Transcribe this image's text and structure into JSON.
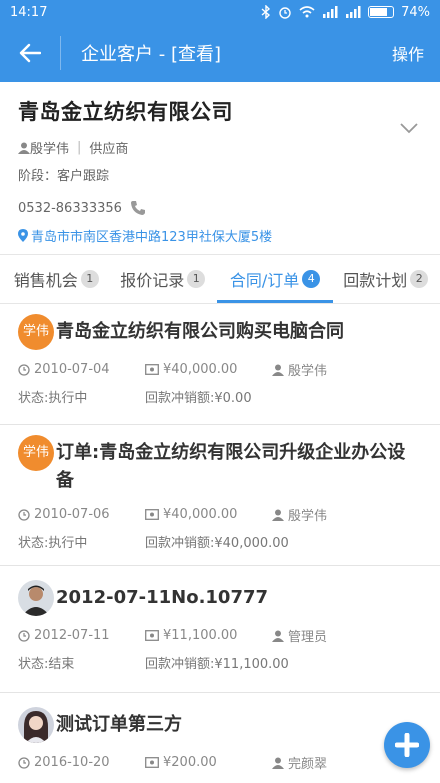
{
  "statusbar": {
    "time": "14:17",
    "battery": "74%"
  },
  "appbar": {
    "title": "企业客户 - [查看]",
    "action": "操作"
  },
  "company": {
    "name": "青岛金立纺织有限公司",
    "owner": "殷学伟",
    "type": "供应商",
    "stage": "阶段：客户跟踪",
    "phone": "0532-86333356",
    "address": "青岛市市南区香港中路123甲社保大厦5楼"
  },
  "tabs": [
    {
      "label": "销售机会",
      "count": "1"
    },
    {
      "label": "报价记录",
      "count": "1"
    },
    {
      "label": "合同/订单",
      "count": "4"
    },
    {
      "label": "回款计划",
      "count": "2"
    }
  ],
  "orders": [
    {
      "avatar_text": "学伟",
      "title": "青岛金立纺织有限公司购买电脑合同",
      "date": "2010-07-04",
      "amount": "¥40,000.00",
      "person": "殷学伟",
      "status": "状态:执行中",
      "writeoff": "回款冲销额:¥0.00"
    },
    {
      "avatar_text": "学伟",
      "title": "订单:青岛金立纺织有限公司升级企业办公设备",
      "date": "2010-07-06",
      "amount": "¥40,000.00",
      "person": "殷学伟",
      "status": "状态:执行中",
      "writeoff": "回款冲销额:¥40,000.00"
    },
    {
      "avatar_text": "",
      "title": "2012-07-11No.10777",
      "date": "2012-07-11",
      "amount": "¥11,100.00",
      "person": "管理员",
      "status": "状态:结束",
      "writeoff": "回款冲销额:¥11,100.00"
    },
    {
      "avatar_text": "",
      "title": "测试订单第三方",
      "date": "2016-10-20",
      "amount": "¥200.00",
      "person": "完颜翠",
      "status": "",
      "writeoff": ""
    }
  ],
  "colors": {
    "primary": "#3a93e6",
    "avatar_orange": "#f08c2e"
  }
}
